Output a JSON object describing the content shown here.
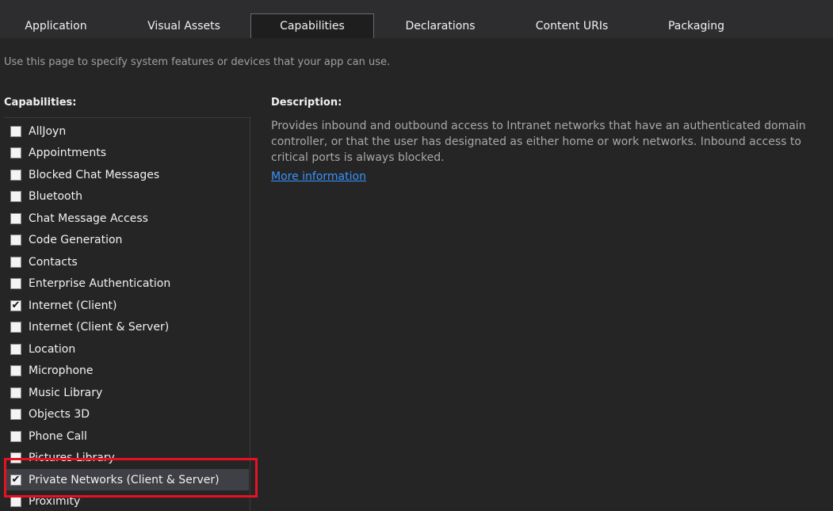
{
  "tabs": [
    {
      "label": "Application"
    },
    {
      "label": "Visual Assets"
    },
    {
      "label": "Capabilities"
    },
    {
      "label": "Declarations"
    },
    {
      "label": "Content URIs"
    },
    {
      "label": "Packaging"
    }
  ],
  "active_tab": "Capabilities",
  "intro_text": "Use this page to specify system features or devices that your app can use.",
  "capabilities_heading": "Capabilities:",
  "capabilities": [
    {
      "label": "AllJoyn",
      "checked": false
    },
    {
      "label": "Appointments",
      "checked": false
    },
    {
      "label": "Blocked Chat Messages",
      "checked": false
    },
    {
      "label": "Bluetooth",
      "checked": false
    },
    {
      "label": "Chat Message Access",
      "checked": false
    },
    {
      "label": "Code Generation",
      "checked": false
    },
    {
      "label": "Contacts",
      "checked": false
    },
    {
      "label": "Enterprise Authentication",
      "checked": false
    },
    {
      "label": "Internet (Client)",
      "checked": true
    },
    {
      "label": "Internet (Client & Server)",
      "checked": false
    },
    {
      "label": "Location",
      "checked": false
    },
    {
      "label": "Microphone",
      "checked": false
    },
    {
      "label": "Music Library",
      "checked": false
    },
    {
      "label": "Objects 3D",
      "checked": false
    },
    {
      "label": "Phone Call",
      "checked": false
    },
    {
      "label": "Pictures Library",
      "checked": false
    },
    {
      "label": "Private Networks (Client & Server)",
      "checked": true,
      "selected": true
    },
    {
      "label": "Proximity",
      "checked": false
    }
  ],
  "description_heading": "Description:",
  "description_text": "Provides inbound and outbound access to Intranet networks that have an authenticated domain controller, or that the user has designated as either home or work networks. Inbound access to critical ports is always blocked.",
  "more_info_label": "More information",
  "colors": {
    "background": "#252526",
    "tab_bar": "#2d2d30",
    "link": "#3794ff",
    "highlight_border": "#e81123",
    "selected_row": "#3f3f46"
  }
}
